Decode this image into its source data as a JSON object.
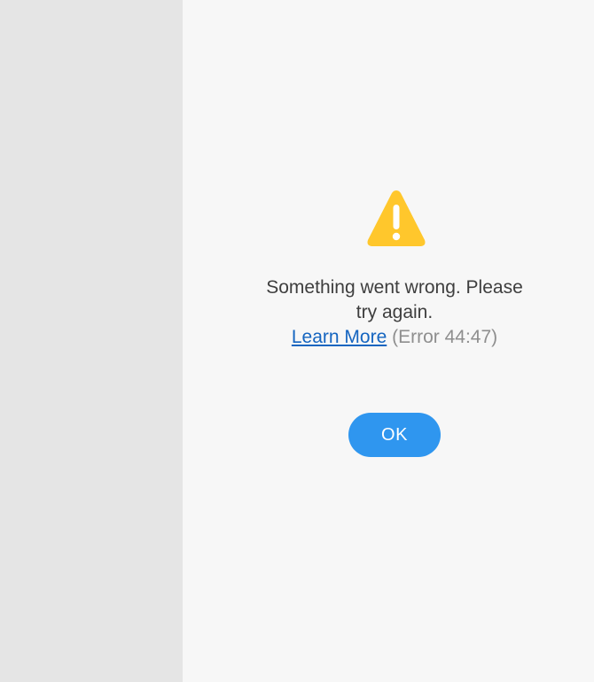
{
  "dialog": {
    "icon": "warning-icon",
    "message_line1": "Something went wrong. Please",
    "message_line2": "try again.",
    "learn_more_label": "Learn More",
    "error_code": "(Error 44:47)",
    "ok_label": "OK"
  },
  "colors": {
    "sidebar_bg": "#e5e5e5",
    "main_bg": "#f7f7f7",
    "warning_yellow": "#ffc72c",
    "link_blue": "#1565c0",
    "button_blue": "#2f96ef"
  }
}
